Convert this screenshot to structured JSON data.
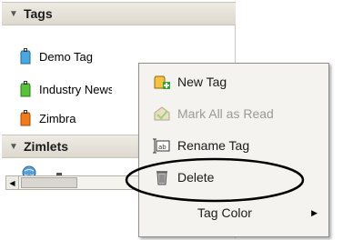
{
  "overview": {
    "sections": [
      {
        "title": "Tags",
        "collapsed": false
      },
      {
        "title": "Zimlets",
        "collapsed": false
      }
    ],
    "tags": [
      {
        "label": "Demo Tag",
        "color": "#4aa8e0"
      },
      {
        "label": "Industry News",
        "color": "#57c23a"
      },
      {
        "label": "Zimbra",
        "color": "#f07a1c"
      }
    ]
  },
  "context_menu": {
    "items": [
      {
        "label": "New Tag",
        "icon": "new-tag-icon",
        "enabled": true
      },
      {
        "label": "Mark All as Read",
        "icon": "mark-read-icon",
        "enabled": false
      },
      {
        "label": "Rename Tag",
        "icon": "rename-icon",
        "enabled": true
      },
      {
        "label": "Delete",
        "icon": "trash-icon",
        "enabled": true
      },
      {
        "label": "Tag Color",
        "icon": "",
        "enabled": true,
        "has_submenu": true
      }
    ]
  }
}
